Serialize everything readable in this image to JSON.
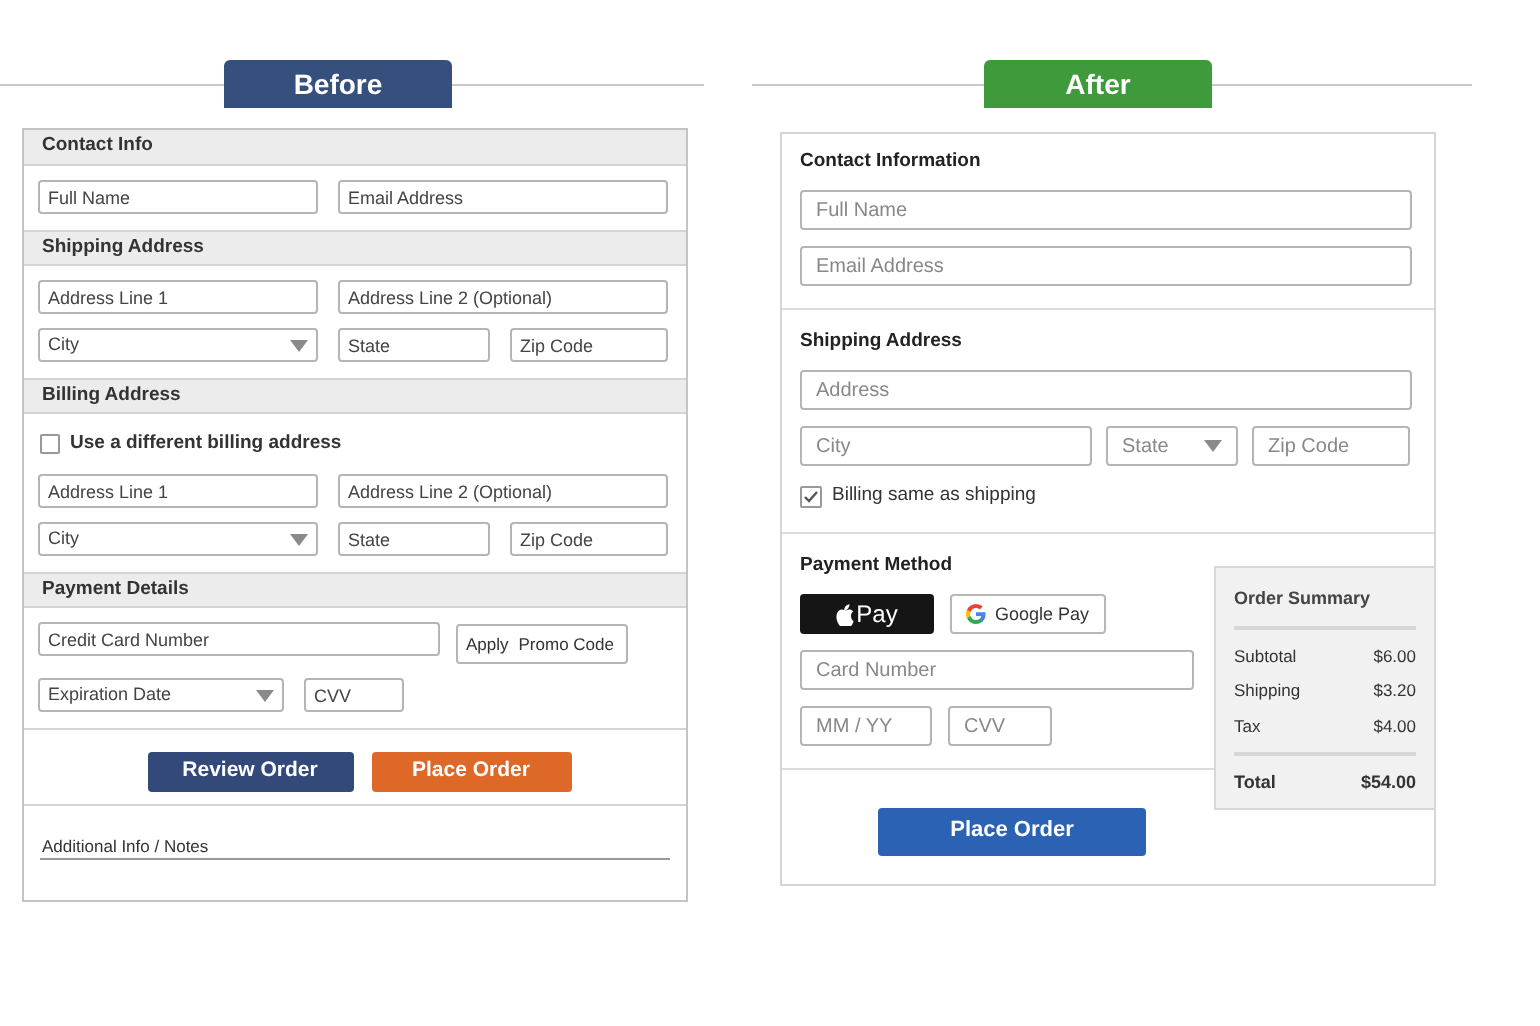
{
  "before": {
    "tab": "Before",
    "sections": [
      {
        "title": "Contact Info",
        "rows": [
          [
            {
              "kind": "text",
              "placeholder": "Full Name"
            },
            {
              "kind": "text",
              "placeholder": "Email Address"
            }
          ]
        ]
      },
      {
        "title": "Shipping Address",
        "rows": [
          [
            {
              "kind": "text",
              "placeholder": "Address Line 1"
            },
            {
              "kind": "text",
              "placeholder": "Address Line 2 (Optional)"
            }
          ],
          [
            {
              "kind": "select",
              "placeholder": "City"
            },
            {
              "kind": "text",
              "placeholder": "State"
            },
            {
              "kind": "text",
              "placeholder": "Zip Code"
            }
          ]
        ]
      },
      {
        "title": "Billing Address",
        "checkbox": {
          "label": "Use a different billing address",
          "checked": false
        },
        "rows": [
          [
            {
              "kind": "text",
              "placeholder": "Address Line 1"
            },
            {
              "kind": "text",
              "placeholder": "Address Line 2 (Optional)"
            }
          ],
          [
            {
              "kind": "select",
              "placeholder": "City"
            },
            {
              "kind": "text",
              "placeholder": "State"
            },
            {
              "kind": "text",
              "placeholder": "Zip Code"
            }
          ]
        ]
      },
      {
        "title": "Payment Details",
        "rows": [
          [
            {
              "kind": "text",
              "placeholder": "Credit Card Number"
            },
            {
              "kind": "promo",
              "label": "Apply",
              "placeholder": "Promo Code"
            }
          ],
          [
            {
              "kind": "select",
              "placeholder": "Expiration Date"
            },
            {
              "kind": "text",
              "placeholder": "CVV"
            }
          ]
        ]
      }
    ],
    "buttons": [
      {
        "label": "Review Order",
        "kind": "secondary"
      },
      {
        "label": "Place Order",
        "kind": "primary"
      }
    ],
    "notes": {
      "placeholder": "Additional Info / Notes"
    }
  },
  "after": {
    "tab": "After",
    "sections": [
      {
        "title": "Contact Information",
        "rows": [
          [
            {
              "kind": "text",
              "placeholder": "Full Name"
            }
          ],
          [
            {
              "kind": "text",
              "placeholder": "Email Address"
            }
          ]
        ]
      },
      {
        "title": "Shipping Address",
        "rows": [
          [
            {
              "kind": "text",
              "placeholder": "Address"
            }
          ],
          [
            {
              "kind": "text",
              "placeholder": "City"
            },
            {
              "kind": "select",
              "placeholder": "State"
            },
            {
              "kind": "text",
              "placeholder": "Zip Code"
            }
          ]
        ],
        "checkbox": {
          "label": "Billing same as shipping",
          "checked": true
        }
      },
      {
        "title": "Payment Method",
        "wallets": [
          {
            "kind": "apple",
            "label": "Pay"
          },
          {
            "kind": "google",
            "label": "Google Pay"
          }
        ],
        "rows": [
          [
            {
              "kind": "text",
              "placeholder": "Card Number"
            }
          ],
          [
            {
              "kind": "text",
              "placeholder": "MM / YY"
            },
            {
              "kind": "text",
              "placeholder": "CVV"
            }
          ]
        ]
      }
    ],
    "button": {
      "label": "Place Order"
    },
    "summary": {
      "title": "Order Summary",
      "items": [
        {
          "label": "Subtotal",
          "value": "$6.00"
        },
        {
          "label": "Shipping",
          "value": "$3.20"
        },
        {
          "label": "Tax",
          "value": "$4.00"
        }
      ],
      "total": {
        "label": "Total",
        "value": "$54.00"
      }
    }
  }
}
